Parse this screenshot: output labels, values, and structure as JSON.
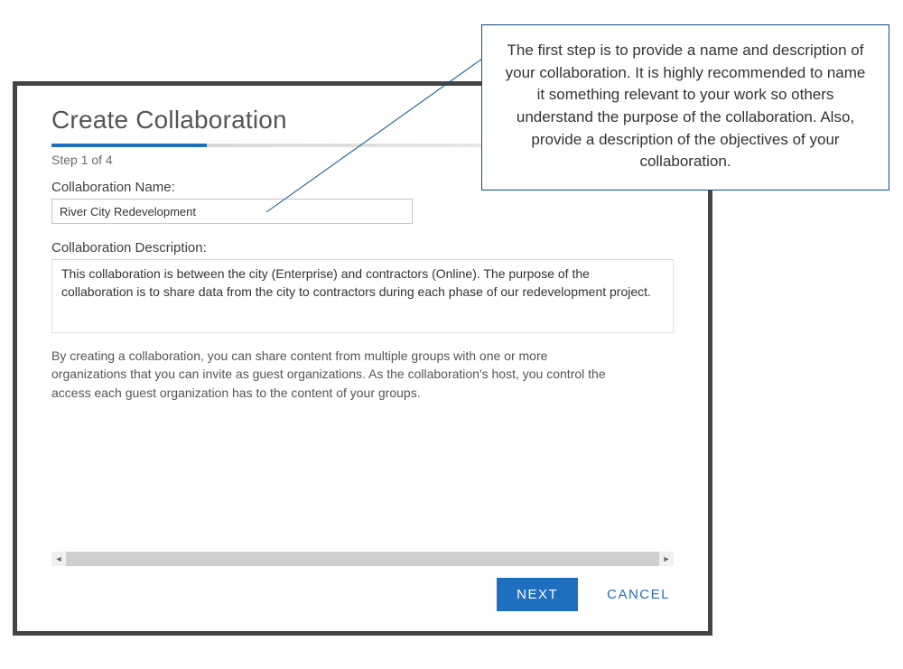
{
  "dialog": {
    "title": "Create Collaboration",
    "step_text": "Step 1 of 4",
    "progress_percent": 25,
    "name_label": "Collaboration Name:",
    "name_value": "River City Redevelopment",
    "desc_label": "Collaboration Description:",
    "desc_value": "This collaboration is between the city (Enterprise) and contractors (Online). The purpose of the collaboration is to share data from the city to contractors during each phase of our redevelopment project.",
    "info_text": "By creating a collaboration, you can share content from multiple groups with one or more organizations that you can invite as guest organizations. As the collaboration's host, you control the access each guest organization has to the content of your groups.",
    "next_label": "NEXT",
    "cancel_label": "CANCEL"
  },
  "callout": {
    "text": "The first step is to provide a name and description of your collaboration. It is highly recommended to name it something relevant to your work so others understand the purpose of the collaboration. Also, provide a description of the objectives of your collaboration."
  }
}
